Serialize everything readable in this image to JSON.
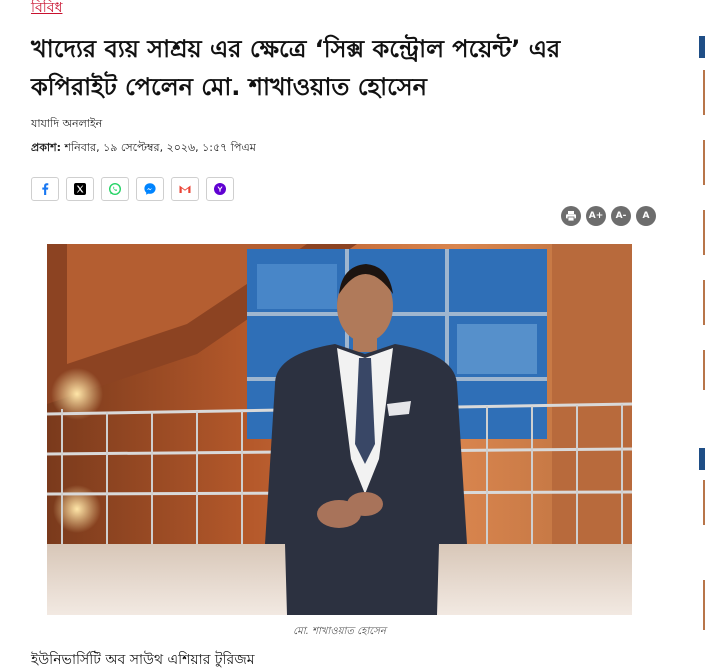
{
  "article": {
    "category": "বিবিধ",
    "headline": "খাদ্যের ব্যয় সাশ্রয় এর ক্ষেত্রে ‘সিক্স কন্ট্রোল পয়েন্ট’ এর কপিরাইট পেলেন মো. শাখাওয়াত হোসেন",
    "author": "যাযাদি অনলাইন",
    "published_label": "প্রকাশ:",
    "published_value": "শনিবার, ১৯ সেপ্টেম্বর, ২০২৬, ১:৫৭ পিএম",
    "caption": "মো. শাখাওয়াত হোসেন",
    "body_start": "ইউনিভার্সিটি অব সাউথ এশিয়ার টুরিজম"
  },
  "share": [
    {
      "name": "facebook-share-button",
      "icon": "facebook-icon",
      "color": "#1877f2"
    },
    {
      "name": "x-share-button",
      "icon": "x-icon",
      "color": "#000000"
    },
    {
      "name": "whatsapp-share-button",
      "icon": "whatsapp-icon",
      "color": "#25d366"
    },
    {
      "name": "messenger-share-button",
      "icon": "messenger-icon",
      "color": "#0084ff"
    },
    {
      "name": "gmail-share-button",
      "icon": "gmail-icon",
      "color": "#ea4335"
    },
    {
      "name": "yahoo-share-button",
      "icon": "yahoo-icon",
      "color": "#6001d2"
    }
  ],
  "tools": {
    "increase_font": "A+",
    "decrease_font": "A-",
    "reset_font": "A",
    "print_icon": "print-icon"
  },
  "colors": {
    "category": "#c8102e",
    "tool_bg": "#6d6d6d",
    "sidebar_accent": "#1f4e86"
  }
}
